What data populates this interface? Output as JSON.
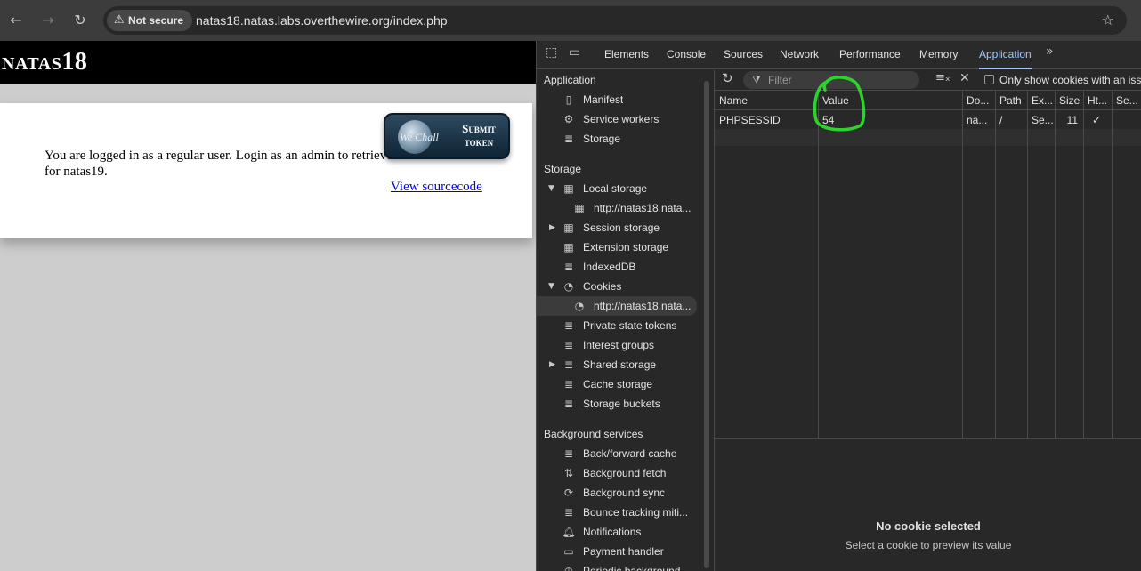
{
  "browser": {
    "security_label": "Not secure",
    "url": "natas18.natas.labs.overthewire.org/index.php"
  },
  "page": {
    "title": "natas18",
    "login_message_line1": "You are logged in as a regular user. Login as an admin to retrieve credentials",
    "login_message_line2": "for natas19.",
    "view_source": "View sourcecode",
    "submit_token_line1": "Submit",
    "submit_token_line2": "token",
    "wechall": "We Chall"
  },
  "devtools": {
    "tabs": [
      "Elements",
      "Console",
      "Sources",
      "Network",
      "Performance",
      "Memory",
      "Application"
    ],
    "active_tab": "Application",
    "sidebar": {
      "application_section": "Application",
      "application_items": [
        "Manifest",
        "Service workers",
        "Storage"
      ],
      "storage_section": "Storage",
      "storage_items": {
        "local_storage": "Local storage",
        "local_storage_origin": "http://natas18.nata...",
        "session_storage": "Session storage",
        "extension_storage": "Extension storage",
        "indexeddb": "IndexedDB",
        "cookies": "Cookies",
        "cookies_origin": "http://natas18.nata...",
        "private_state_tokens": "Private state tokens",
        "interest_groups": "Interest groups",
        "shared_storage": "Shared storage",
        "cache_storage": "Cache storage",
        "storage_buckets": "Storage buckets"
      },
      "background_section": "Background services",
      "background_items": [
        "Back/forward cache",
        "Background fetch",
        "Background sync",
        "Bounce tracking miti...",
        "Notifications",
        "Payment handler",
        "Periodic background..."
      ]
    },
    "filter_placeholder": "Filter",
    "only_show_label": "Only show cookies with an issue",
    "table": {
      "headers": [
        "Name",
        "Value",
        "Do...",
        "Path",
        "Ex...",
        "Size",
        "Ht...",
        "Se..."
      ],
      "rows": [
        [
          "PHPSESSID",
          "54",
          "na...",
          "/",
          "Se...",
          "11",
          "✓",
          ""
        ]
      ]
    },
    "empty_state": {
      "title": "No cookie selected",
      "subtitle": "Select a cookie to preview its value"
    }
  },
  "colors": {
    "annotation": "#2bd32b",
    "active_tab": "#a8c7fa"
  }
}
